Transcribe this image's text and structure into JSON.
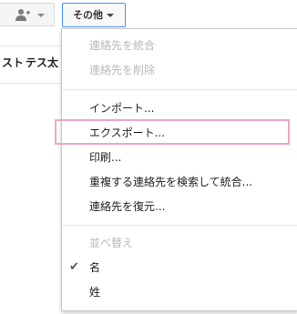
{
  "toolbar": {
    "add_contact_icon": "person-add-icon",
    "more_label": "その他"
  },
  "background_list": {
    "col1": "スト",
    "col2": "テス太"
  },
  "menu": {
    "items": [
      {
        "label": "連絡先を統合",
        "state": "disabled"
      },
      {
        "label": "連絡先を削除",
        "state": "disabled"
      },
      {
        "label": "インポート...",
        "state": "enabled"
      },
      {
        "label": "エクスポート...",
        "state": "enabled",
        "highlighted": true
      },
      {
        "label": "印刷...",
        "state": "enabled"
      },
      {
        "label": "重複する連絡先を検索して統合...",
        "state": "enabled"
      },
      {
        "label": "連絡先を復元...",
        "state": "enabled"
      },
      {
        "label": "並べ替え",
        "state": "header"
      },
      {
        "label": "名",
        "state": "checked"
      },
      {
        "label": "姓",
        "state": "enabled"
      }
    ]
  },
  "colors": {
    "more_button_border": "#4d90fe",
    "highlight_border": "#f0a4c8",
    "disabled_text": "#b8b8b8"
  }
}
